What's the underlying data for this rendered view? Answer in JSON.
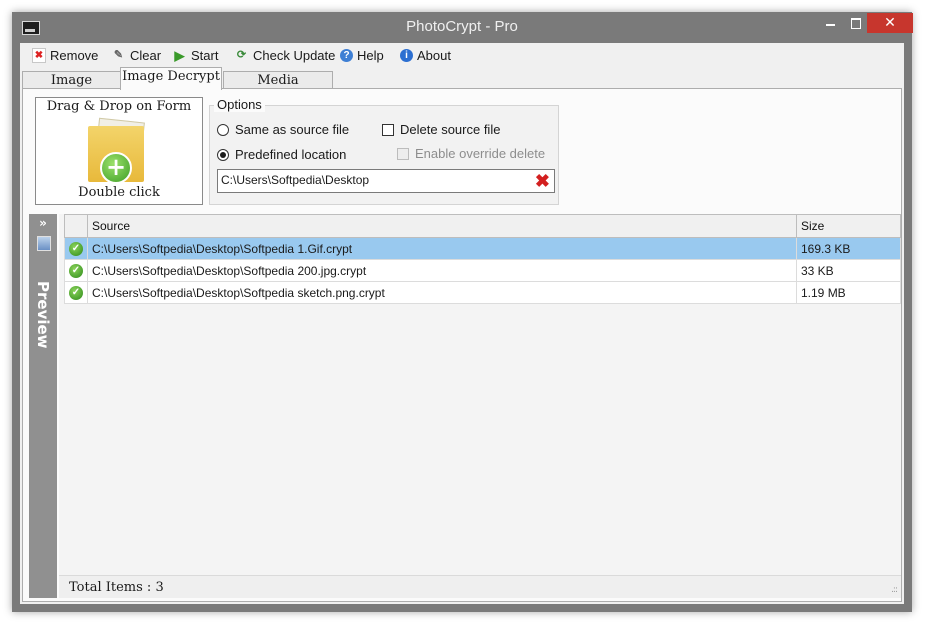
{
  "window": {
    "title": "PhotoCrypt - Pro",
    "close_glyph": "✕"
  },
  "toolbar": {
    "remove": "Remove",
    "clear": "Clear",
    "start": "Start",
    "check_update": "Check Update",
    "help": "Help",
    "about": "About",
    "icons": {
      "remove": "remove-icon",
      "clear": "clear-icon",
      "start": "start-icon",
      "check_update": "check-update-icon",
      "help": "help-icon",
      "about": "info-icon"
    }
  },
  "tabs": [
    {
      "label": "Image Encrypt",
      "active": false
    },
    {
      "label": "Image Decrypt",
      "active": true
    },
    {
      "label": "Media Protection",
      "active": false
    }
  ],
  "dropzone": {
    "title": "Drag & Drop on Form",
    "subtitle": "Double click"
  },
  "options": {
    "legend": "Options",
    "same_as_source": {
      "label": "Same as source file",
      "selected": false
    },
    "predefined_location": {
      "label": "Predefined location",
      "selected": true
    },
    "delete_source": {
      "label": "Delete source file",
      "checked": false
    },
    "enable_override_delete": {
      "label": "Enable override delete",
      "checked": false,
      "enabled": false
    },
    "location_path": "C:\\Users\\Softpedia\\Desktop"
  },
  "preview": {
    "label": "Preview",
    "chevron": "»"
  },
  "grid": {
    "columns": [
      "",
      "Source",
      "Size"
    ],
    "rows": [
      {
        "status": "ok",
        "source": "C:\\Users\\Softpedia\\Desktop\\Softpedia 1.Gif.crypt",
        "size": "169.3 KB",
        "selected": true
      },
      {
        "status": "ok",
        "source": "C:\\Users\\Softpedia\\Desktop\\Softpedia 200.jpg.crypt",
        "size": "33 KB",
        "selected": false
      },
      {
        "status": "ok",
        "source": "C:\\Users\\Softpedia\\Desktop\\Softpedia sketch.png.crypt",
        "size": "1.19 MB",
        "selected": false
      }
    ]
  },
  "footer": {
    "total_label": "Total Items :",
    "total_value": "3"
  },
  "colors": {
    "title_bar": "#7a7a7a",
    "close_button": "#c7362d",
    "selected_row": "#99c9ef",
    "status_ok": "#3e9e24"
  }
}
